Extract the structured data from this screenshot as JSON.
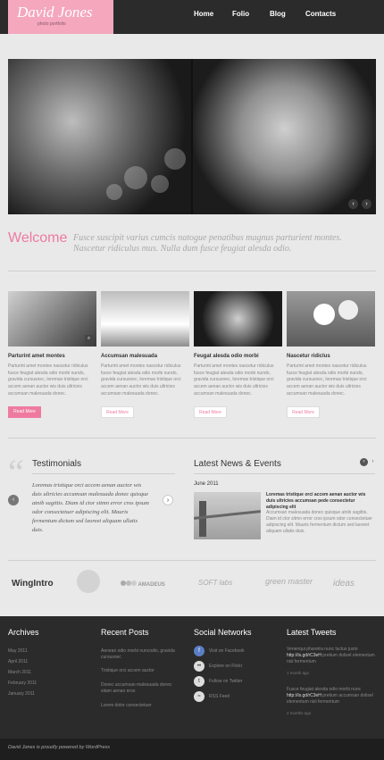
{
  "header": {
    "logo_first": "David",
    "logo_last": "Jones",
    "logo_sub": "photo portfolio",
    "nav": [
      "Home",
      "Folio",
      "Blog",
      "Contacts"
    ]
  },
  "welcome": {
    "title": "Welcome",
    "text": "Fusce suscipit varius cumcis natogue penatibus magnus parturient montes. Nascetur ridiculus mus. Nulla dum fusce feugiat alesda odio."
  },
  "cards": [
    {
      "title": "Parturint  amet montes",
      "text": "Parturint  amet montes nascetur ridiculus fusce feugiat alesda odio morbi nundo, gravida cursusnec, loremas tristique orci accem aenan auctor  wis duis ultricies accumsan malesuada donec.",
      "button": "Read More"
    },
    {
      "title": "Accumsan malesuada",
      "text": "Parturint  amet montes nascetur ridiculus fusce feugiat alesda odio morbi nundo, gravida cursusnec, loremas tristique orci accem aenan auctor  wis duis ultricies accumsan malesuada donec.",
      "button": "Read More"
    },
    {
      "title": "Feugat alesda odio morbi",
      "text": "Parturint  amet montes nascetur ridiculus fusce feugiat alesda odio morbi nundo, gravida cursusnec, loremas tristique orci accem aenan auctor  wis duis ultricies accumsan malesuada donec.",
      "button": "Read More"
    },
    {
      "title": "Nascetur ridiclus",
      "text": "Parturint  amet montes nascetur ridiculus fusce feugiat alesda odio morbi nundo, gravida cursusnec, loremas tristique orci accem aenan auctor  wis duis ultricies accumsan malesuada donec.",
      "button": "Read More"
    }
  ],
  "testimonials": {
    "title": "Testimonials",
    "text": "Loremas tristique orci accem aenan auctor  wis duis ultricies accumsan malesuada donec quisque atnib sagittis. Diam id ctor sitmn error cros ipsum odor consectetuer adipiscing elit. Mauris fermentum dictum sed laoreet aliquam ullatis duis."
  },
  "news": {
    "title": "Latest News & Events",
    "date": "June 2011",
    "headline": "Loremas tristique orci accem aenan auctor  wis duis ultricies accumsan pede consectetur adipiscing elit",
    "text": "Accumsan malesuada donec quisque atnib sagittis. Diam id ctor sitmn error cros ipsum odor consectetuer adipiscing elit. Mauris fermentum dictum sed laoreet aliquam ullatis duis."
  },
  "brands": [
    "WingIntro",
    "AMADEUS",
    "SOFT labs",
    "green master",
    "ideas"
  ],
  "footer": {
    "archives_title": "Archives",
    "archives": [
      "May 2011",
      "April 2011",
      "March 2011",
      "February 2011",
      "January 2011"
    ],
    "posts_title": "Recent Posts",
    "posts": [
      "Aenean odio morbi nuncodio, gravida cursusnec",
      "Tristique orci accem auctor",
      "Donec accumsan malesuada donec sitam aenan eros",
      "Lorem dolor consectetuer"
    ],
    "social_title": "Social Networks",
    "social": [
      "Visit on Facebook",
      "Explore on Flickr",
      "Follow on Twitter",
      "RSS Feed"
    ],
    "tweets_title": "Latest Tweets",
    "tweets": [
      {
        "pre": "Venenqui pharetra nunc luctus justo ",
        "link": "http://is.gd/rC3eH",
        "post": " pretium dolisel elementum nisl fermentum",
        "time": "1 month ago"
      },
      {
        "pre": "Fusce feugiat alesda odio morbi nunc ",
        "link": "http://is.gd/rC3eH",
        "post": " pretium accumsan dolisel elementum nisl fermentum",
        "time": "2 months ago"
      }
    ],
    "copyright": "David Jones is proudly powered by WordPress"
  },
  "colors": {
    "accent": "#ee7aa0",
    "header": "#2b2b2b",
    "background": "#e9e9e9"
  }
}
